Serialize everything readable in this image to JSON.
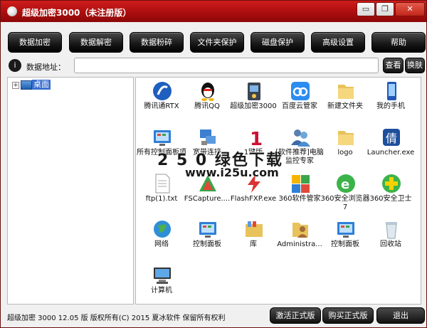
{
  "window": {
    "title": "超级加密3000（未注册版）",
    "controls": {
      "minimize": "▭",
      "restore": "❐",
      "close": "✕"
    }
  },
  "toolbar": {
    "buttons": [
      "数据加密",
      "数据解密",
      "数据粉碎",
      "文件夹保护",
      "磁盘保护",
      "高级设置",
      "帮助"
    ]
  },
  "address": {
    "label": "数据地址：",
    "value": "",
    "view_label": "查看",
    "skin_label": "换肤"
  },
  "tree": {
    "root_label": "桌面",
    "expander": "+"
  },
  "files": [
    {
      "name": "腾讯通RTX",
      "icon": "rtx-icon"
    },
    {
      "name": "腾讯QQ",
      "icon": "qq-penguin-icon"
    },
    {
      "name": "超级加密3000",
      "icon": "encrypt-app-icon"
    },
    {
      "name": "百度云管家",
      "icon": "baidu-cloud-icon"
    },
    {
      "name": "新建文件夹",
      "icon": "folder-icon"
    },
    {
      "name": "我的手机",
      "icon": "phone-icon"
    },
    {
      "name": "所有控制面板项",
      "icon": "control-panel-icon"
    },
    {
      "name": "宽带连接",
      "icon": "network-icon"
    },
    {
      "name": "1键版",
      "icon": "one-key-icon"
    },
    {
      "name": "[软件推荐]电脑监控专家",
      "icon": "users-icon"
    },
    {
      "name": "logo",
      "icon": "folder-icon"
    },
    {
      "name": "Launcher.exe",
      "icon": "launcher-icon"
    },
    {
      "name": "ftp(1).txt",
      "icon": "text-file-icon"
    },
    {
      "name": "FSCapture....",
      "icon": "fscapture-icon"
    },
    {
      "name": "FlashFXP.exe",
      "icon": "flashfxp-icon"
    },
    {
      "name": "360软件管家",
      "icon": "360-manager-icon"
    },
    {
      "name": "360安全浏览器7",
      "icon": "360-browser-icon"
    },
    {
      "name": "360安全卫士",
      "icon": "360-guard-icon"
    },
    {
      "name": "网络",
      "icon": "globe-icon"
    },
    {
      "name": "控制面板",
      "icon": "control-panel-icon"
    },
    {
      "name": "库",
      "icon": "library-icon"
    },
    {
      "name": "Administra...",
      "icon": "user-folder-icon"
    },
    {
      "name": "控制面板",
      "icon": "control-panel-icon"
    },
    {
      "name": "回收站",
      "icon": "recycle-bin-icon"
    },
    {
      "name": "计算机",
      "icon": "computer-icon"
    }
  ],
  "watermark": {
    "line1": "2 5 0 绿色下载",
    "line2": "www.i25u.com"
  },
  "status": {
    "text": "超级加密 3000  12.05 版   版权所有(C)  2015 夏冰软件  保留所有权利",
    "activate_label": "激活正式版",
    "buy_label": "购买正式版",
    "exit_label": "退出"
  },
  "colors": {
    "title_red": "#b51212",
    "button_black": "#1a1a1a",
    "selection_blue": "#3a6fd0"
  }
}
